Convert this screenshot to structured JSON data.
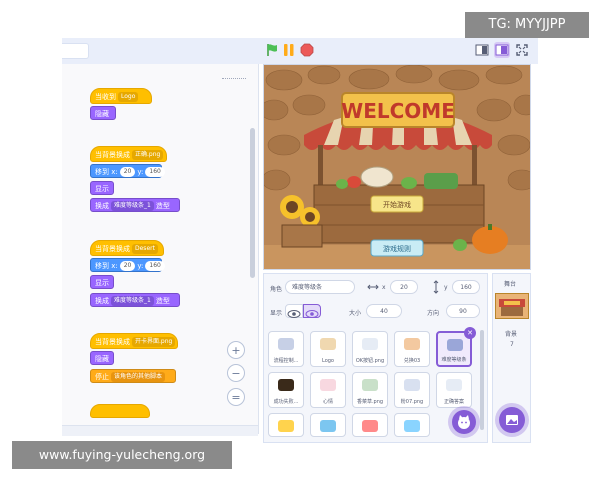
{
  "overlay": {
    "top_right_tag": "TG: MYYJJPP",
    "bottom_watermark": "www.fuying-yulecheng.org"
  },
  "toolbar": {
    "green_flag_icon": "green-flag-icon",
    "pause_icon": "pause-icon",
    "stop_icon": "stop-icon",
    "layout_small_icon": "small-stage-icon",
    "layout_normal_icon": "normal-stage-icon",
    "fullscreen_icon": "fullscreen-icon"
  },
  "scripts": [
    {
      "hat": {
        "label": "当收到",
        "dropdown": "Logo"
      },
      "blocks": [
        {
          "kind": "purple",
          "text": "隐藏"
        }
      ]
    },
    {
      "hat": {
        "label": "当背景换成",
        "dropdown": "正确.png"
      },
      "blocks": [
        {
          "kind": "blue",
          "text": "移到 x:",
          "x": "20",
          "ylabel": "y:",
          "y": "160"
        },
        {
          "kind": "purple",
          "text": "显示"
        },
        {
          "kind": "purple",
          "text": "换成",
          "costume": "难度等级条_1",
          "suffix": "造型"
        }
      ]
    },
    {
      "hat": {
        "label": "当背景换成",
        "dropdown": "Desert"
      },
      "blocks": [
        {
          "kind": "blue",
          "text": "移到 x:",
          "x": "20",
          "ylabel": "y:",
          "y": "160"
        },
        {
          "kind": "purple",
          "text": "显示"
        },
        {
          "kind": "purple",
          "text": "换成",
          "costume": "难度等级条_1",
          "suffix": "造型"
        }
      ]
    },
    {
      "hat": {
        "label": "当背景换成",
        "dropdown": "开卡界面.png"
      },
      "blocks": [
        {
          "kind": "purple",
          "text": "隐藏"
        },
        {
          "kind": "orange",
          "text": "停止",
          "dropdown": "该角色的其他脚本"
        }
      ]
    }
  ],
  "zoom": {
    "in": "+",
    "out": "−",
    "reset": "="
  },
  "stage_scene": {
    "sign_text": "WELCOME",
    "button_start": "开始游戏",
    "button_rules": "游戏规则"
  },
  "sprite_info": {
    "sprite_label": "角色",
    "sprite_name": "难度等级条",
    "x_label": "x",
    "x_value": "20",
    "y_label": "y",
    "y_value": "160",
    "show_label": "显示",
    "size_label": "大小",
    "size_value": "40",
    "direction_label": "方向",
    "direction_value": "90"
  },
  "sprites": [
    {
      "name": "流程控制...",
      "selected": false
    },
    {
      "name": "Logo",
      "selected": false
    },
    {
      "name": "OK按钮.png",
      "selected": false
    },
    {
      "name": "兑换03",
      "selected": false
    },
    {
      "name": "难度等级条",
      "selected": true
    },
    {
      "name": "成功失败...",
      "selected": false
    },
    {
      "name": "心情",
      "selected": false
    },
    {
      "name": "香菜草.png",
      "selected": false
    },
    {
      "name": "粉07.png",
      "selected": false
    },
    {
      "name": "正确答案",
      "selected": false
    },
    {
      "name": "",
      "selected": false
    },
    {
      "name": "",
      "selected": false
    },
    {
      "name": "",
      "selected": false
    },
    {
      "name": "",
      "selected": false
    }
  ],
  "stage_panel": {
    "title": "舞台",
    "backdrops_label": "背景",
    "backdrops_count": "7"
  },
  "colors": {
    "event": "#ffbf00",
    "looks": "#9966ff",
    "motion": "#4c97ff",
    "control": "#ffab19",
    "accent": "#855cd6"
  }
}
